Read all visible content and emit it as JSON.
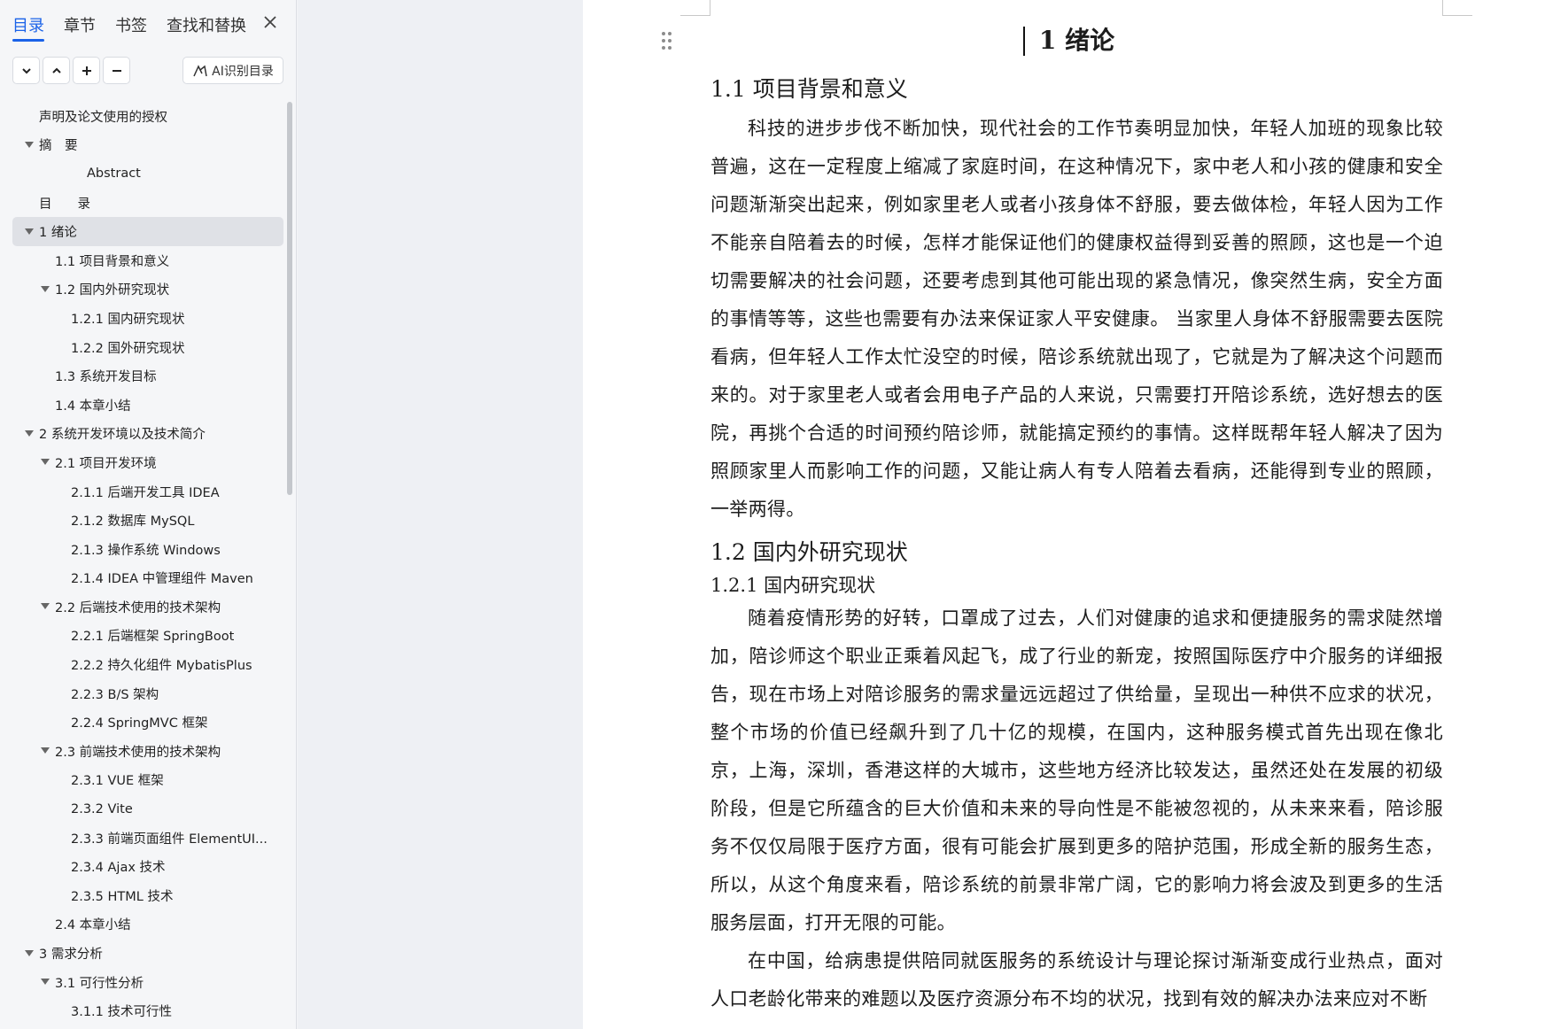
{
  "nav": {
    "tabs": [
      "目录",
      "章节",
      "书签",
      "查找和替换"
    ],
    "active_tab": "目录",
    "toolbar": {
      "collapse_icon": "chevron-down-icon",
      "expand_icon": "chevron-up-icon",
      "add_icon": "plus-icon",
      "remove_icon": "minus-icon",
      "ai_label": "AI识别目录"
    },
    "toc": [
      {
        "label": "声明及论文使用的授权",
        "level": 1,
        "arrow": false
      },
      {
        "label": "摘　要",
        "level": 1,
        "arrow": true
      },
      {
        "label": "Abstract",
        "level": 3,
        "arrow": false
      },
      {
        "label": "目　　录",
        "level": 1,
        "arrow": false
      },
      {
        "label": "1 绪论",
        "level": 1,
        "arrow": true,
        "selected": true
      },
      {
        "label": "1.1 项目背景和意义",
        "level": 2,
        "arrow": false
      },
      {
        "label": "1.2 国内外研究现状",
        "level": 2,
        "arrow": true
      },
      {
        "label": "1.2.1  国内研究现状",
        "level": 3,
        "arrow": false
      },
      {
        "label": "1.2.2  国外研究现状",
        "level": 3,
        "arrow": false
      },
      {
        "label": "1.3 系统开发目标",
        "level": 2,
        "arrow": false
      },
      {
        "label": "1.4 本章小结",
        "level": 2,
        "arrow": false
      },
      {
        "label": "2 系统开发环境以及技术简介",
        "level": 1,
        "arrow": true
      },
      {
        "label": "2.1 项目开发环境",
        "level": 2,
        "arrow": true
      },
      {
        "label": "2.1.1  后端开发工具 IDEA",
        "level": 3,
        "arrow": false
      },
      {
        "label": "2.1.2  数据库 MySQL",
        "level": 3,
        "arrow": false
      },
      {
        "label": "2.1.3  操作系统 Windows",
        "level": 3,
        "arrow": false
      },
      {
        "label": "2.1.4 IDEA 中管理组件 Maven",
        "level": 3,
        "arrow": false
      },
      {
        "label": "2.2 后端技术使用的技术架构",
        "level": 2,
        "arrow": true
      },
      {
        "label": "2.2.1  后端框架 SpringBoot",
        "level": 3,
        "arrow": false
      },
      {
        "label": "2.2.2  持久化组件 MybatisPlus",
        "level": 3,
        "arrow": false
      },
      {
        "label": "2.2.3 B/S 架构",
        "level": 3,
        "arrow": false
      },
      {
        "label": "2.2.4 SpringMVC 框架",
        "level": 3,
        "arrow": false
      },
      {
        "label": "2.3 前端技术使用的技术架构",
        "level": 2,
        "arrow": true
      },
      {
        "label": "2.3.1 VUE 框架",
        "level": 3,
        "arrow": false
      },
      {
        "label": "2.3.2 Vite",
        "level": 3,
        "arrow": false
      },
      {
        "label": "2.3.3  前端页面组件 ElementUI...",
        "level": 3,
        "arrow": false
      },
      {
        "label": "2.3.4 Ajax 技术",
        "level": 3,
        "arrow": false
      },
      {
        "label": "2.3.5 HTML 技术",
        "level": 3,
        "arrow": false
      },
      {
        "label": "2.4 本章小结",
        "level": 2,
        "arrow": false
      },
      {
        "label": "3 需求分析",
        "level": 1,
        "arrow": true
      },
      {
        "label": "3.1 可行性分析",
        "level": 2,
        "arrow": true
      },
      {
        "label": "3.1.1  技术可行性",
        "level": 3,
        "arrow": false
      }
    ]
  },
  "doc": {
    "chapter_title": "1 绪论",
    "section_1_1": "1.1 项目背景和意义",
    "para_1": "科技的进步步伐不断加快，现代社会的工作节奏明显加快，年轻人加班的现象比较普遍，这在一定程度上缩减了家庭时间，在这种情况下，家中老人和小孩的健康和安全问题渐渐突出起来，例如家里老人或者小孩身体不舒服，要去做体检，年轻人因为工作不能亲自陪着去的时候，怎样才能保证他们的健康权益得到妥善的照顾，这也是一个迫切需要解决的社会问题，还要考虑到其他可能出现的紧急情况，像突然生病，安全方面的事情等等，这些也需要有办法来保证家人平安健康。 当家里人身体不舒服需要去医院看病，但年轻人工作太忙没空的时候，陪诊系统就出现了，它就是为了解决这个问题而来的。对于家里老人或者会用电子产品的人来说，只需要打开陪诊系统，选好想去的医院，再挑个合适的时间预约陪诊师，就能搞定预约的事情。这样既帮年轻人解决了因为照顾家里人而影响工作的问题，又能让病人有专人陪着去看病，还能得到专业的照顾，一举两得。",
    "section_1_2": "1.2 国内外研究现状",
    "section_1_2_1": "1.2.1  国内研究现状",
    "para_2": "随着疫情形势的好转，口罩成了过去，人们对健康的追求和便捷服务的需求陡然增加，陪诊师这个职业正乘着风起飞，成了行业的新宠，按照国际医疗中介服务的详细报告，现在市场上对陪诊服务的需求量远远超过了供给量，呈现出一种供不应求的状况，整个市场的价值已经飙升到了几十亿的规模，在国内，这种服务模式首先出现在像北京，上海，深圳，香港这样的大城市，这些地方经济比较发达，虽然还处在发展的初级阶段，但是它所蕴含的巨大价值和未来的导向性是不能被忽视的，从未来来看，陪诊服务不仅仅局限于医疗方面，很有可能会扩展到更多的陪护范围，形成全新的服务生态，所以，从这个角度来看，陪诊系统的前景非常广阔，它的影响力将会波及到更多的生活服务层面，打开无限的可能。",
    "para_3": "在中国，给病患提供陪同就医服务的系统设计与理论探讨渐渐变成行业热点，面对人口老龄化带来的难题以及医疗资源分布不均的状况，找到有效的解决办法来应对不断"
  }
}
